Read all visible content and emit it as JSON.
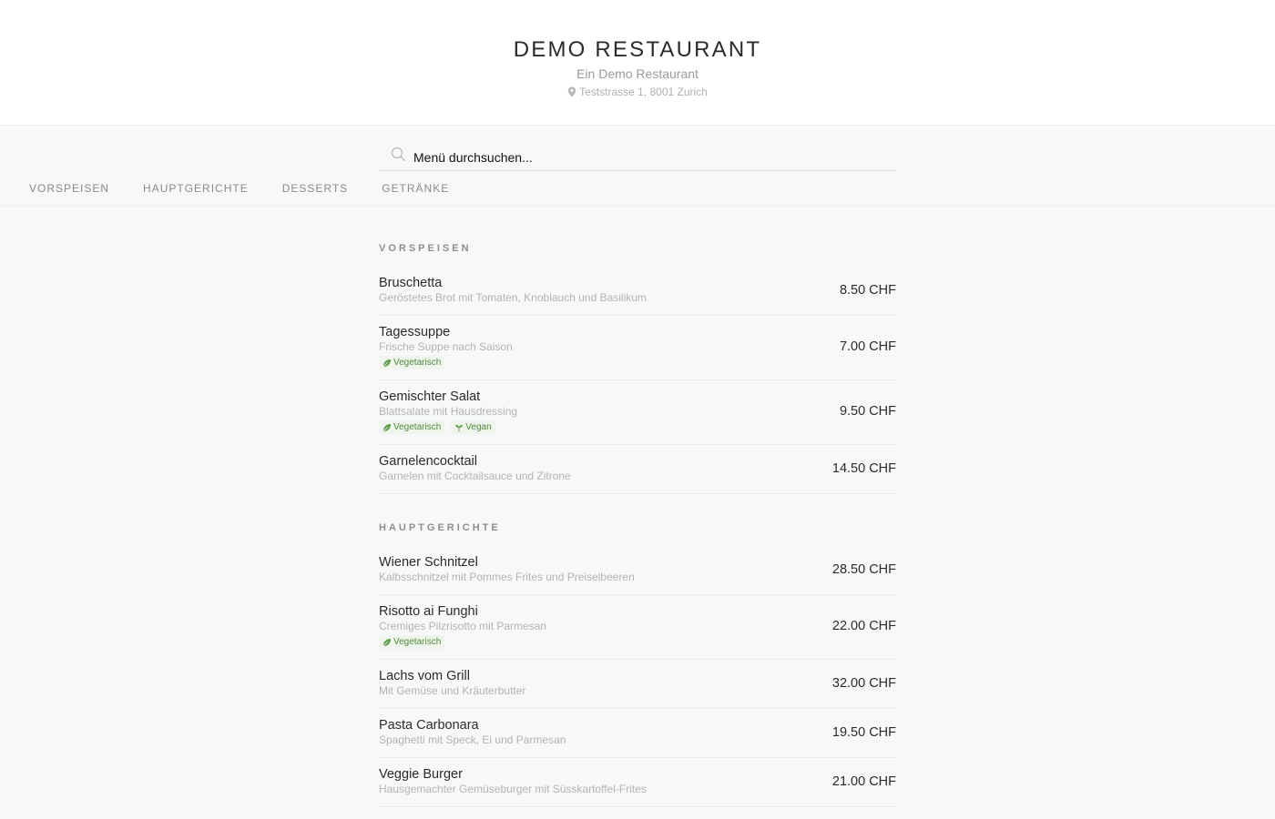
{
  "header": {
    "name": "DEMO RESTAURANT",
    "subtitle": "Ein Demo Restaurant",
    "address": "Teststrasse 1, 8001 Zurich"
  },
  "search": {
    "placeholder": "Menü durchsuchen..."
  },
  "tabs": [
    "VORSPEISEN",
    "HAUPTGERICHTE",
    "DESSERTS",
    "GETRÄNKE"
  ],
  "colors": {
    "background": "#f7f8fa",
    "tag_green": "#4f8a3d"
  },
  "sections": [
    {
      "title": "VORSPEISEN",
      "items": [
        {
          "name": "Bruschetta",
          "desc": "Geröstetes Brot mit Tomaten, Knoblauch und Basilikum",
          "price": "8.50 CHF",
          "tags": []
        },
        {
          "name": "Tagessuppe",
          "desc": "Frische Suppe nach Saison",
          "price": "7.00 CHF",
          "tags": [
            "Vegetarisch"
          ]
        },
        {
          "name": "Gemischter Salat",
          "desc": "Blattsalate mit Hausdressing",
          "price": "9.50 CHF",
          "tags": [
            "Vegetarisch",
            "Vegan"
          ]
        },
        {
          "name": "Garnelencocktail",
          "desc": "Garnelen mit Cocktailsauce und Zitrone",
          "price": "14.50 CHF",
          "tags": []
        }
      ]
    },
    {
      "title": "HAUPTGERICHTE",
      "items": [
        {
          "name": "Wiener Schnitzel",
          "desc": "Kalbsschnitzel mit Pommes Frites und Preiselbeeren",
          "price": "28.50 CHF",
          "tags": []
        },
        {
          "name": "Risotto ai Funghi",
          "desc": "Cremiges Pilzrisotto mit Parmesan",
          "price": "22.00 CHF",
          "tags": [
            "Vegetarisch"
          ]
        },
        {
          "name": "Lachs vom Grill",
          "desc": "Mit Gemüse und Kräuterbutter",
          "price": "32.00 CHF",
          "tags": []
        },
        {
          "name": "Pasta Carbonara",
          "desc": "Spaghetti mit Speck, Ei und Parmesan",
          "price": "19.50 CHF",
          "tags": []
        },
        {
          "name": "Veggie Burger",
          "desc": "Hausgemachter Gemüseburger mit Süsskartoffel-Frites",
          "price": "21.00 CHF",
          "tags": []
        }
      ]
    }
  ]
}
